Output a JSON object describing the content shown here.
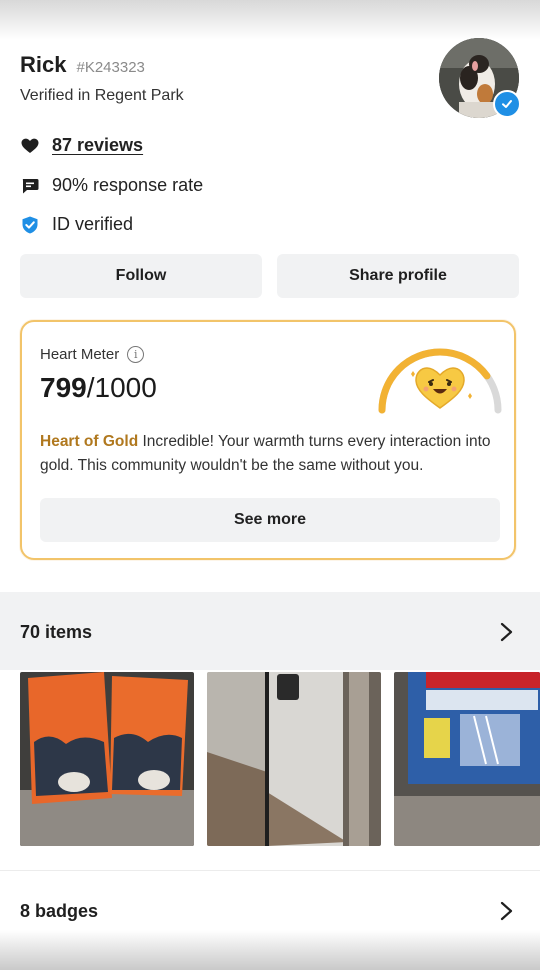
{
  "profile": {
    "name": "Rick",
    "user_id": "#K243323",
    "verified_location": "Verified in Regent Park"
  },
  "stats": {
    "reviews": "87 reviews",
    "response_rate": "90% response rate",
    "id_verified": "ID verified"
  },
  "actions": {
    "follow": "Follow",
    "share": "Share profile"
  },
  "heart_meter": {
    "title": "Heart Meter",
    "info_glyph": "i",
    "score": "799",
    "max": "/1000",
    "level": "Heart of Gold",
    "description": " Incredible! Your warmth turns every interaction into gold. This community wouldn't be the same without you.",
    "see_more": "See more",
    "fill_fraction": 0.799
  },
  "items": {
    "title": "70 items"
  },
  "badges": {
    "title": "8 badges"
  },
  "colors": {
    "accent_gold": "#f2b233",
    "verified_blue": "#1f8fe5",
    "level_text": "#b0781e"
  }
}
